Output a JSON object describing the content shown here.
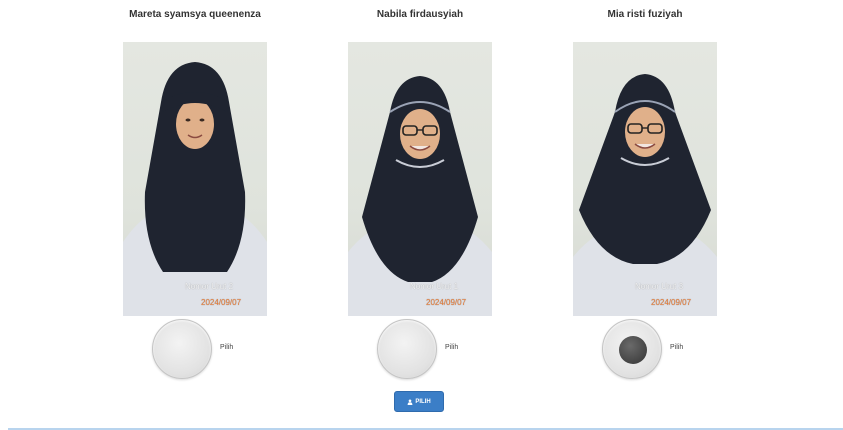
{
  "candidates": [
    {
      "name": "Mareta syamsya queenenza",
      "photo_stamp": "Nomor Urut 2",
      "photo_stamp_date": "2024/09/07",
      "radio_label": "Pilih",
      "selected": false
    },
    {
      "name": "Nabila firdausyiah",
      "photo_stamp": "Nomor Urut 1",
      "photo_stamp_date": "2024/09/07",
      "radio_label": "Pilih",
      "selected": false
    },
    {
      "name": "Mia risti fuziyah",
      "photo_stamp": "Nomor Urut 3",
      "photo_stamp_date": "2024/09/07",
      "radio_label": "Pilih",
      "selected": true
    }
  ],
  "submit_button": {
    "label": "PILIH",
    "icon": "user-icon"
  },
  "colors": {
    "button_bg": "#3b7ec7",
    "hijab": "#1f2430",
    "footer_rule": "#b8d4ee"
  }
}
